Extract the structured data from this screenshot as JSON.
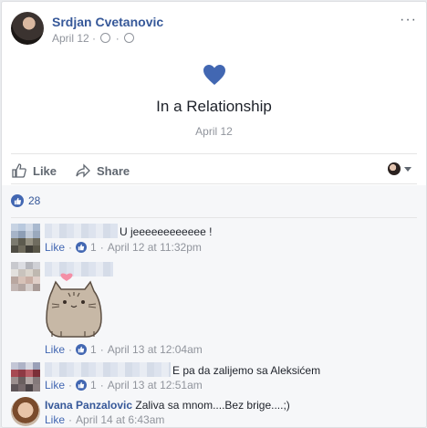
{
  "post": {
    "author": "Srdjan Cvetanovic",
    "date": "April 12",
    "more_label": "···"
  },
  "event": {
    "title": "In a Relationship",
    "date": "April 12",
    "heart_color": "#4267b2"
  },
  "actions": {
    "like_label": "Like",
    "share_label": "Share"
  },
  "reactions": {
    "count": "28"
  },
  "comments": [
    {
      "text": "U jeeeeeeeeeeee !",
      "like": "Like",
      "likes": "1",
      "time": "April 12 at 11:32pm"
    },
    {
      "sticker": "pusheen-heart",
      "like": "Like",
      "likes": "1",
      "time": "April 13 at 12:04am"
    },
    {
      "text": "E pa da zalijemo sa Aleksićem",
      "like": "Like",
      "likes": "1",
      "time": "April 13 at 12:51am"
    },
    {
      "author": "Ivana Panzalovic",
      "text": "Zaliva sa mnom....Bez brige....;)",
      "like": "Like",
      "time": "April 14 at 6:43am"
    }
  ],
  "colors": {
    "link": "#365899",
    "accent": "#4267b2",
    "muted": "#90949c"
  }
}
